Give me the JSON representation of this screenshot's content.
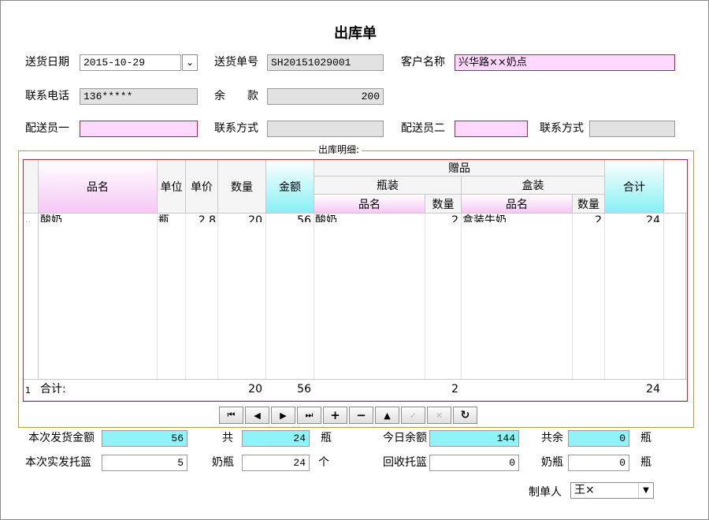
{
  "form": {
    "title": "出库单",
    "send_date_label": "送货日期",
    "send_date_value": "2015-10-29",
    "send_no_label": "送货单号",
    "send_no_value": "SH20151029001",
    "customer_label": "客户名称",
    "customer_value": "兴华路××奶点",
    "phone_label": "联系电话",
    "phone_value": "136*****",
    "balance_label_a": "余",
    "balance_label_b": "款",
    "balance_value": "200",
    "deliver1_label": "配送员一",
    "deliver1_value": "",
    "contact1_label": "联系方式",
    "contact1_value": "",
    "deliver2_label": "配送员二",
    "deliver2_value": "",
    "contact2_label": "联系方式",
    "contact2_value": ""
  },
  "grid": {
    "group_title": "出库明细:",
    "headers": {
      "name": "品名",
      "unit": "单位",
      "price": "单价",
      "qty": "数量",
      "amount": "金额",
      "gift": "赠品",
      "bottle": "瓶装",
      "box": "盒装",
      "bottle_name": "品名",
      "bottle_qty": "数量",
      "box_name": "品名",
      "box_qty": "数量",
      "total": "合计"
    },
    "row1": {
      "indicator": "‥",
      "name": "酸奶",
      "unit": "瓶",
      "price": "2.8",
      "qty": "20",
      "amount": "56",
      "bottle_name": "酸奶",
      "bottle_qty": "2",
      "box_name": "盒装牛奶",
      "box_qty": "2",
      "total": "24"
    },
    "footer": {
      "indicator": "1",
      "label": "合计:",
      "qty": "20",
      "amount": "56",
      "bottle_qty": "2",
      "total": "24"
    }
  },
  "nav": {
    "first": "⏮",
    "prev": "◀",
    "next": "▶",
    "last": "⏭",
    "add": "+",
    "delete": "−",
    "up": "▲",
    "post": "✓",
    "cancel": "✕",
    "refresh": "↻"
  },
  "summary": {
    "ship_amount_label": "本次发货金额",
    "ship_amount_value": "56",
    "total_label": "共",
    "total_value": "24",
    "total_unit": "瓶",
    "today_balance_label": "今日余额",
    "today_balance_value": "144",
    "remain_label": "共余",
    "remain_value": "0",
    "remain_unit": "瓶",
    "baskets_label": "本次实发托篮",
    "baskets_value": "5",
    "milk_bottle_label": "奶瓶",
    "milk_bottle_value": "24",
    "milk_bottle_unit": "个",
    "recycle_label": "回收托篮",
    "recycle_value": "0",
    "milk_bottle2_label": "奶瓶",
    "milk_bottle2_value": "0",
    "milk_bottle2_unit": "瓶",
    "maker_label": "制单人",
    "maker_value": "王×"
  },
  "colors": {
    "pink": "#ffd8ff",
    "cyan": "#8ff4f8",
    "gray": "#e2e2e2",
    "red_border": "#c81e2c"
  }
}
